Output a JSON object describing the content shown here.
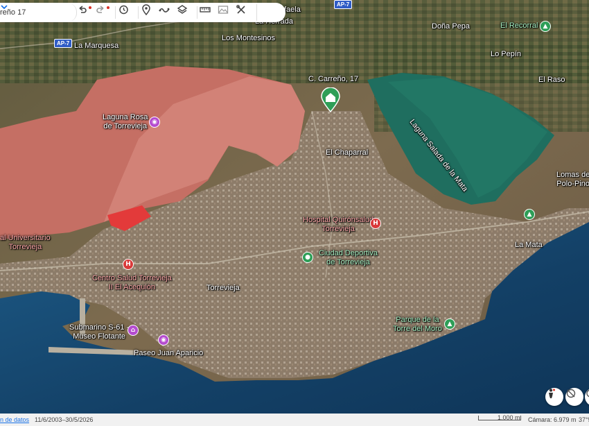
{
  "search": {
    "value": "reño 17"
  },
  "toolbar": {
    "undo": "undo-icon",
    "redo": "redo-icon",
    "history": "history-icon",
    "place": "pin-icon",
    "path": "path-icon",
    "layers": "layers-icon",
    "measure": "ruler-icon",
    "image": "image-overlay-icon",
    "tools": "tools-icon",
    "more": "chevron-down-icon"
  },
  "map": {
    "places": {
      "calle": "C. Carreño, 17",
      "la_marquesa": "La Marquesa",
      "los_montesinos": "Los Montesinos",
      "la_herrada": "La Herrada",
      "faela": "faela",
      "dona_pepa": "Doña Pepa",
      "el_recorral": "El Recorral",
      "lo_pepin": "Lo Pepín",
      "el_raso": "El Raso",
      "laguna_rosa": "Laguna Rosa\nde Torrevieja",
      "laguna_salada": "Laguna Salada de la Mata",
      "el_chaparral": "El Chaparral",
      "lomas": "Lomas de\nPolo-Pino",
      "hospital": "Hospital Quirónsalud\nTorrevieja",
      "la_mata": "La Mata",
      "hosp_univ": "al Universitario\nTorrevieja",
      "ciudad_deportiva": "Ciudad Deportiva\nde Torrevieja",
      "centro_salud": "Centro Salud Torrevieja\nII El Acequión",
      "torrevieja": "Torrevieja",
      "submarino": "Submarino S-61 -\nMuseo Flotante",
      "paseo": "Paseo Juan Aparicio",
      "parque_torre": "Parque de la\nTorre del Moro"
    },
    "shields": {
      "ap7_left": "AP-7",
      "ap7_top": "AP-7"
    }
  },
  "status": {
    "datos": "n de datos",
    "dates": "11/6/2003–30/5/2026",
    "scale": "1.000 m",
    "camera": "Cámara: 6.979 m",
    "coord": "37°5"
  },
  "colors": {
    "lagoon_pink": "#c56f64",
    "lagoon_green": "#1f6e5f",
    "sea": "#17476e",
    "land": "#7b6a4e"
  }
}
